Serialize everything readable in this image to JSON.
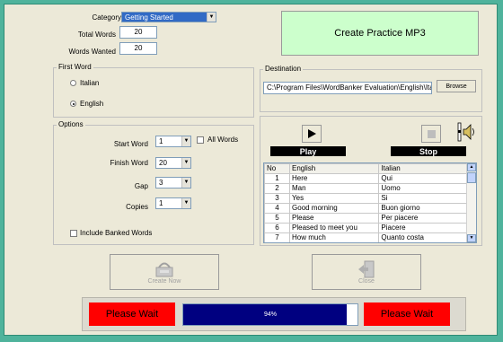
{
  "form": {
    "category_label": "Category",
    "category_value": "Getting Started",
    "total_words_label": "Total Words",
    "total_words_value": "20",
    "words_wanted_label": "Words Wanted",
    "words_wanted_value": "20"
  },
  "first_word": {
    "legend": "First Word",
    "option_italian": "Italian",
    "option_english": "English",
    "selected": "English"
  },
  "options": {
    "legend": "Options",
    "start_word_label": "Start Word",
    "start_word_value": "1",
    "all_words_label": "All Words",
    "finish_word_label": "Finish Word",
    "finish_word_value": "20",
    "gap_label": "Gap",
    "gap_value": "3",
    "copies_label": "Copies",
    "copies_value": "1",
    "include_banked_label": "Include Banked Words"
  },
  "create_mp3_label": "Create Practice MP3",
  "destination": {
    "legend": "Destination",
    "path": "C:\\Program Files\\WordBanker Evaluation\\English\\Ital",
    "browse_label": "Browse"
  },
  "player": {
    "play_label": "Play",
    "stop_label": "Stop"
  },
  "word_table": {
    "columns": [
      "No",
      "English",
      "Italian"
    ],
    "rows": [
      [
        "1",
        "Here",
        "Qui"
      ],
      [
        "2",
        "Man",
        "Uomo"
      ],
      [
        "3",
        "Yes",
        "Si"
      ],
      [
        "4",
        "Good morning",
        "Buon giorno"
      ],
      [
        "5",
        "Please",
        "Per piacere"
      ],
      [
        "6",
        "Pleased to meet you",
        "Piacere"
      ],
      [
        "7",
        "How much",
        "Quanto costa"
      ]
    ]
  },
  "buttons": {
    "create_now_label": "Create Now",
    "close_label": "Close"
  },
  "status": {
    "left_text": "Please Wait",
    "right_text": "Please Wait",
    "progress_text": "94%",
    "progress_value": 0.94
  },
  "colors": {
    "background": "#4fb39c",
    "window": "#ece9d8",
    "mp3_button": "#ccffcc",
    "wait_box": "#ff0000",
    "progress_fill": "#000080"
  }
}
